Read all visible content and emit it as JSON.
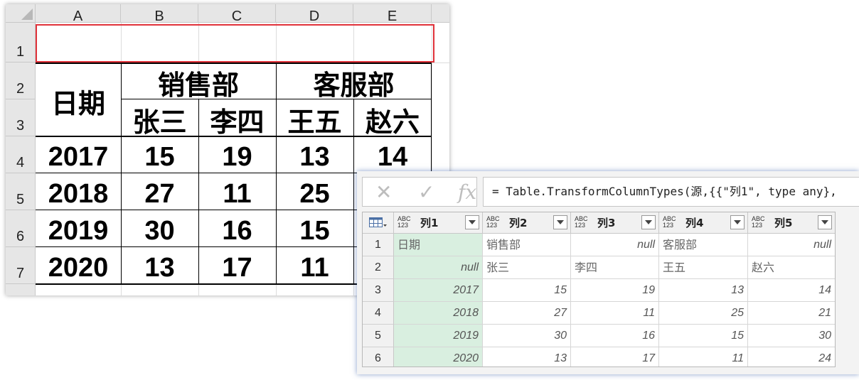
{
  "excel": {
    "columns": [
      "A",
      "B",
      "C",
      "D",
      "E"
    ],
    "rows": [
      "1",
      "2",
      "3",
      "4",
      "5",
      "6",
      "7"
    ],
    "header": {
      "date": "日期",
      "sales_dept": "销售部",
      "service_dept": "客服部",
      "p1": "张三",
      "p2": "李四",
      "p3": "王五",
      "p4": "赵六"
    },
    "data": [
      [
        "2017",
        "15",
        "19",
        "13",
        "14"
      ],
      [
        "2018",
        "27",
        "11",
        "25",
        ""
      ],
      [
        "2019",
        "30",
        "16",
        "15",
        ""
      ],
      [
        "2020",
        "13",
        "17",
        "11",
        ""
      ]
    ],
    "selection_color": "#e0323a"
  },
  "pq": {
    "cancel_glyph": "✕",
    "confirm_glyph": "✓",
    "fx_label": "fx",
    "formula": "= Table.TransformColumnTypes(源,{{\"列1\", type any},",
    "type_icon_top": "ABC",
    "type_icon_bottom": "123",
    "columns": [
      "列1",
      "列2",
      "列3",
      "列4",
      "列5"
    ],
    "row_numbers": [
      "1",
      "2",
      "3",
      "4",
      "5",
      "6"
    ],
    "rows": [
      [
        "日期",
        "销售部",
        "null",
        "客服部",
        "null"
      ],
      [
        "null",
        "张三",
        "李四",
        "王五",
        "赵六"
      ],
      [
        "2017",
        "15",
        "19",
        "13",
        "14"
      ],
      [
        "2018",
        "27",
        "11",
        "25",
        "21"
      ],
      [
        "2019",
        "30",
        "16",
        "15",
        "30"
      ],
      [
        "2020",
        "13",
        "17",
        "11",
        "24"
      ]
    ],
    "selected_column_color": "#d9efe0"
  }
}
